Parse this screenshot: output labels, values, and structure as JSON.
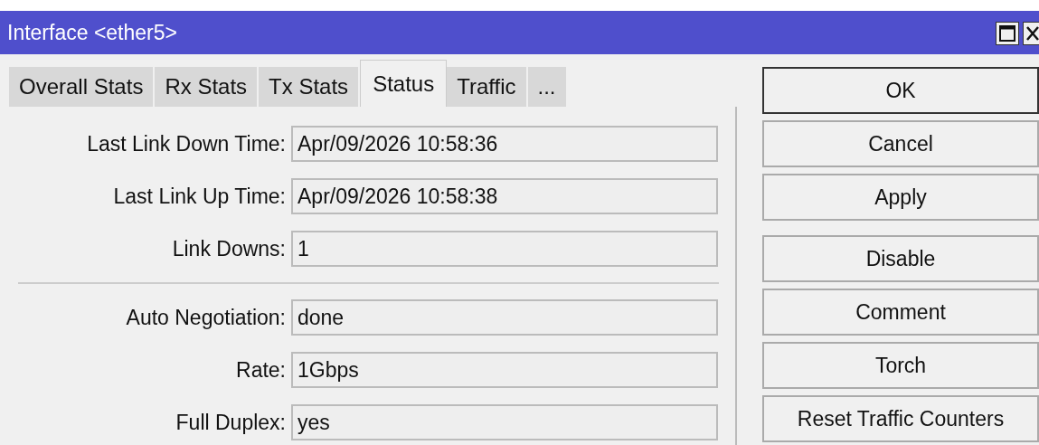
{
  "window": {
    "title": "Interface <ether5>"
  },
  "tabs": [
    {
      "label": "Overall Stats",
      "selected": false
    },
    {
      "label": "Rx Stats",
      "selected": false
    },
    {
      "label": "Tx Stats",
      "selected": false
    },
    {
      "label": "Status",
      "selected": true
    },
    {
      "label": "Traffic",
      "selected": false
    },
    {
      "label": "...",
      "selected": false
    }
  ],
  "field_groups": [
    {
      "fields": [
        {
          "label": "Last Link Down Time:",
          "value": "Apr/09/2026 10:58:36"
        },
        {
          "label": "Last Link Up Time:",
          "value": "Apr/09/2026 10:58:38"
        },
        {
          "label": "Link Downs:",
          "value": "1"
        }
      ]
    },
    {
      "fields": [
        {
          "label": "Auto Negotiation:",
          "value": "done"
        },
        {
          "label": "Rate:",
          "value": "1Gbps"
        },
        {
          "label": "Full Duplex:",
          "value": "yes"
        }
      ]
    }
  ],
  "button_groups": [
    {
      "buttons": [
        {
          "label": "OK",
          "default": true
        },
        {
          "label": "Cancel",
          "default": false
        },
        {
          "label": "Apply",
          "default": false
        }
      ]
    },
    {
      "buttons": [
        {
          "label": "Disable",
          "default": false
        },
        {
          "label": "Comment",
          "default": false
        },
        {
          "label": "Torch",
          "default": false
        },
        {
          "label": "Reset Traffic Counters",
          "default": false
        }
      ]
    }
  ]
}
